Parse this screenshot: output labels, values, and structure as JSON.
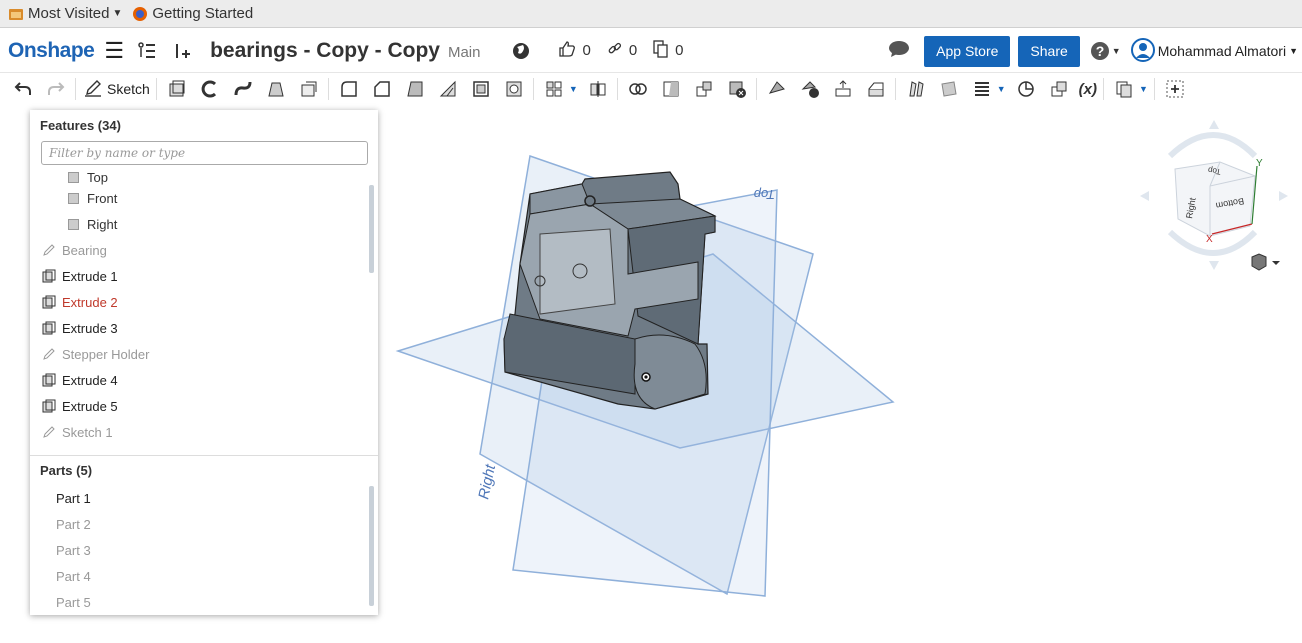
{
  "bookmarks": {
    "most_visited": "Most Visited",
    "getting_started": "Getting Started"
  },
  "header": {
    "logo": "Onshape",
    "doc_title": "bearings - Copy - Copy",
    "branch": "Main",
    "likes": "0",
    "links": "0",
    "copies": "0",
    "app_store": "App Store",
    "share": "Share",
    "user": "Mohammad Almatori"
  },
  "toolbar": {
    "sketch_label": "Sketch",
    "variable_label": "(x)"
  },
  "features": {
    "title": "Features (34)",
    "filter_placeholder": "Filter by name or type",
    "items": [
      {
        "label": "Top",
        "kind": "plane",
        "state": "normal"
      },
      {
        "label": "Front",
        "kind": "plane",
        "state": "normal"
      },
      {
        "label": "Right",
        "kind": "plane",
        "state": "normal"
      },
      {
        "label": "Bearing",
        "kind": "sketch",
        "state": "dimmed"
      },
      {
        "label": "Extrude 1",
        "kind": "extrude",
        "state": "normal"
      },
      {
        "label": "Extrude 2",
        "kind": "extrude",
        "state": "error"
      },
      {
        "label": "Extrude 3",
        "kind": "extrude",
        "state": "normal"
      },
      {
        "label": "Stepper Holder",
        "kind": "sketch",
        "state": "dimmed"
      },
      {
        "label": "Extrude 4",
        "kind": "extrude",
        "state": "normal"
      },
      {
        "label": "Extrude 5",
        "kind": "extrude",
        "state": "normal"
      },
      {
        "label": "Sketch 1",
        "kind": "sketch",
        "state": "dimmed"
      }
    ]
  },
  "parts": {
    "title": "Parts (5)",
    "items": [
      {
        "label": "Part 1",
        "state": "normal"
      },
      {
        "label": "Part 2",
        "state": "dimmed"
      },
      {
        "label": "Part 3",
        "state": "dimmed"
      },
      {
        "label": "Part 4",
        "state": "dimmed"
      },
      {
        "label": "Part 5",
        "state": "dimmed"
      }
    ]
  },
  "viewport": {
    "plane_labels": {
      "top": "Top",
      "right": "Right"
    },
    "view_cube": {
      "top": "Top",
      "right": "Right",
      "bottom": "Bottom",
      "axis_x": "X",
      "axis_y": "Y"
    }
  },
  "colors": {
    "accent": "#1565b8",
    "logo": "#1e64b4",
    "error": "#c0392b",
    "plane": "#a9c3e4",
    "model": "#6f7b86"
  }
}
